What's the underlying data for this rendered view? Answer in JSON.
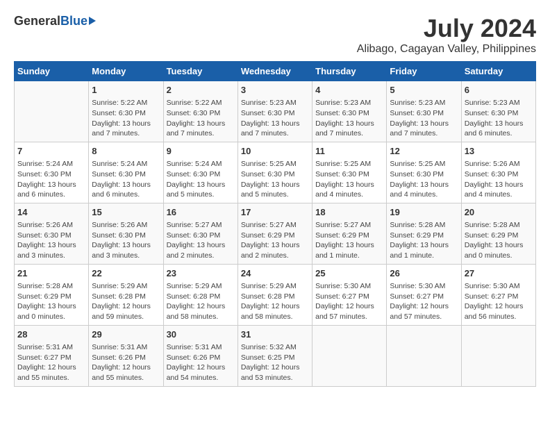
{
  "logo": {
    "general": "General",
    "blue": "Blue"
  },
  "title": "July 2024",
  "subtitle": "Alibago, Cagayan Valley, Philippines",
  "headers": [
    "Sunday",
    "Monday",
    "Tuesday",
    "Wednesday",
    "Thursday",
    "Friday",
    "Saturday"
  ],
  "weeks": [
    [
      {
        "day": "",
        "info": ""
      },
      {
        "day": "1",
        "info": "Sunrise: 5:22 AM\nSunset: 6:30 PM\nDaylight: 13 hours\nand 7 minutes."
      },
      {
        "day": "2",
        "info": "Sunrise: 5:22 AM\nSunset: 6:30 PM\nDaylight: 13 hours\nand 7 minutes."
      },
      {
        "day": "3",
        "info": "Sunrise: 5:23 AM\nSunset: 6:30 PM\nDaylight: 13 hours\nand 7 minutes."
      },
      {
        "day": "4",
        "info": "Sunrise: 5:23 AM\nSunset: 6:30 PM\nDaylight: 13 hours\nand 7 minutes."
      },
      {
        "day": "5",
        "info": "Sunrise: 5:23 AM\nSunset: 6:30 PM\nDaylight: 13 hours\nand 7 minutes."
      },
      {
        "day": "6",
        "info": "Sunrise: 5:23 AM\nSunset: 6:30 PM\nDaylight: 13 hours\nand 6 minutes."
      }
    ],
    [
      {
        "day": "7",
        "info": "Sunrise: 5:24 AM\nSunset: 6:30 PM\nDaylight: 13 hours\nand 6 minutes."
      },
      {
        "day": "8",
        "info": "Sunrise: 5:24 AM\nSunset: 6:30 PM\nDaylight: 13 hours\nand 6 minutes."
      },
      {
        "day": "9",
        "info": "Sunrise: 5:24 AM\nSunset: 6:30 PM\nDaylight: 13 hours\nand 5 minutes."
      },
      {
        "day": "10",
        "info": "Sunrise: 5:25 AM\nSunset: 6:30 PM\nDaylight: 13 hours\nand 5 minutes."
      },
      {
        "day": "11",
        "info": "Sunrise: 5:25 AM\nSunset: 6:30 PM\nDaylight: 13 hours\nand 4 minutes."
      },
      {
        "day": "12",
        "info": "Sunrise: 5:25 AM\nSunset: 6:30 PM\nDaylight: 13 hours\nand 4 minutes."
      },
      {
        "day": "13",
        "info": "Sunrise: 5:26 AM\nSunset: 6:30 PM\nDaylight: 13 hours\nand 4 minutes."
      }
    ],
    [
      {
        "day": "14",
        "info": "Sunrise: 5:26 AM\nSunset: 6:30 PM\nDaylight: 13 hours\nand 3 minutes."
      },
      {
        "day": "15",
        "info": "Sunrise: 5:26 AM\nSunset: 6:30 PM\nDaylight: 13 hours\nand 3 minutes."
      },
      {
        "day": "16",
        "info": "Sunrise: 5:27 AM\nSunset: 6:30 PM\nDaylight: 13 hours\nand 2 minutes."
      },
      {
        "day": "17",
        "info": "Sunrise: 5:27 AM\nSunset: 6:29 PM\nDaylight: 13 hours\nand 2 minutes."
      },
      {
        "day": "18",
        "info": "Sunrise: 5:27 AM\nSunset: 6:29 PM\nDaylight: 13 hours\nand 1 minute."
      },
      {
        "day": "19",
        "info": "Sunrise: 5:28 AM\nSunset: 6:29 PM\nDaylight: 13 hours\nand 1 minute."
      },
      {
        "day": "20",
        "info": "Sunrise: 5:28 AM\nSunset: 6:29 PM\nDaylight: 13 hours\nand 0 minutes."
      }
    ],
    [
      {
        "day": "21",
        "info": "Sunrise: 5:28 AM\nSunset: 6:29 PM\nDaylight: 13 hours\nand 0 minutes."
      },
      {
        "day": "22",
        "info": "Sunrise: 5:29 AM\nSunset: 6:28 PM\nDaylight: 12 hours\nand 59 minutes."
      },
      {
        "day": "23",
        "info": "Sunrise: 5:29 AM\nSunset: 6:28 PM\nDaylight: 12 hours\nand 58 minutes."
      },
      {
        "day": "24",
        "info": "Sunrise: 5:29 AM\nSunset: 6:28 PM\nDaylight: 12 hours\nand 58 minutes."
      },
      {
        "day": "25",
        "info": "Sunrise: 5:30 AM\nSunset: 6:27 PM\nDaylight: 12 hours\nand 57 minutes."
      },
      {
        "day": "26",
        "info": "Sunrise: 5:30 AM\nSunset: 6:27 PM\nDaylight: 12 hours\nand 57 minutes."
      },
      {
        "day": "27",
        "info": "Sunrise: 5:30 AM\nSunset: 6:27 PM\nDaylight: 12 hours\nand 56 minutes."
      }
    ],
    [
      {
        "day": "28",
        "info": "Sunrise: 5:31 AM\nSunset: 6:27 PM\nDaylight: 12 hours\nand 55 minutes."
      },
      {
        "day": "29",
        "info": "Sunrise: 5:31 AM\nSunset: 6:26 PM\nDaylight: 12 hours\nand 55 minutes."
      },
      {
        "day": "30",
        "info": "Sunrise: 5:31 AM\nSunset: 6:26 PM\nDaylight: 12 hours\nand 54 minutes."
      },
      {
        "day": "31",
        "info": "Sunrise: 5:32 AM\nSunset: 6:25 PM\nDaylight: 12 hours\nand 53 minutes."
      },
      {
        "day": "",
        "info": ""
      },
      {
        "day": "",
        "info": ""
      },
      {
        "day": "",
        "info": ""
      }
    ]
  ]
}
